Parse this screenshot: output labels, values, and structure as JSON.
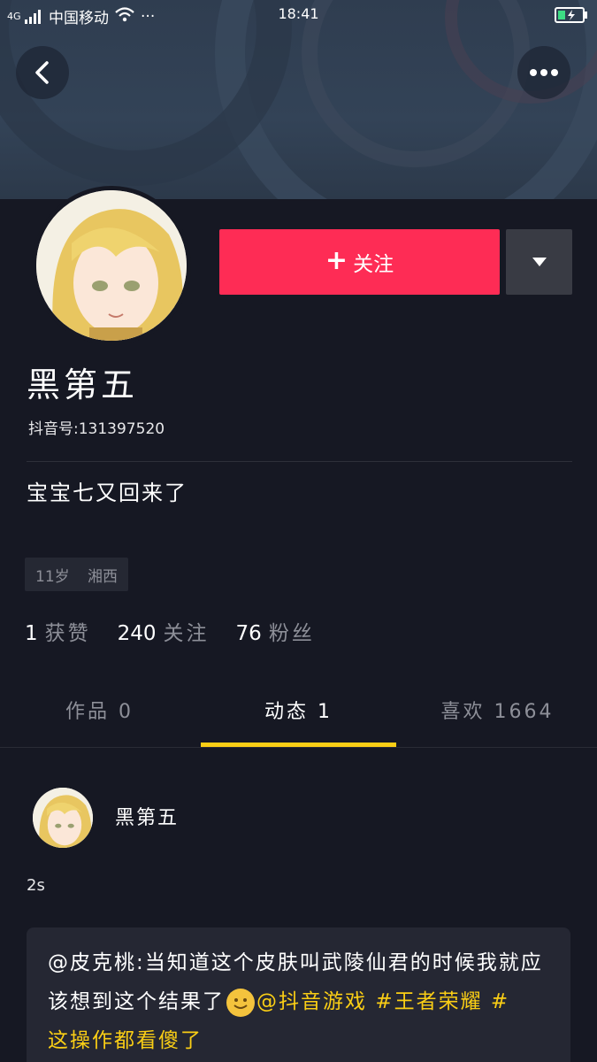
{
  "status_bar": {
    "signal": "4G",
    "carrier": "中国移动",
    "more": "···",
    "time": "18:41"
  },
  "header": {
    "back_icon": "chevron-left-icon",
    "more_icon": "more-dots-icon"
  },
  "profile": {
    "follow_label": "关注",
    "name": "黑第五",
    "douyin_id": "抖音号:131397520",
    "bio": "宝宝七又回来了",
    "tags": [
      "11岁",
      "湘西"
    ],
    "stats": [
      {
        "num": "1",
        "label": "获赞"
      },
      {
        "num": "240",
        "label": "关注"
      },
      {
        "num": "76",
        "label": "粉丝"
      }
    ]
  },
  "tabs": [
    {
      "label": "作品 0",
      "active": false
    },
    {
      "label": "动态 1",
      "active": true
    },
    {
      "label": "喜欢 1664",
      "active": false
    }
  ],
  "post": {
    "author": "黑第五",
    "time": "2s",
    "text_part1": "@皮克桃:当知道这个皮肤叫武陵仙君的时候我就应该想到这个结果了",
    "mention": "@抖音游戏",
    "hashtag1": "#王者荣耀",
    "hashtag2": "#",
    "text_part2": "这操作都看傻了"
  },
  "colors": {
    "accent": "#fe2c55",
    "highlight": "#face15",
    "background": "#161823"
  }
}
